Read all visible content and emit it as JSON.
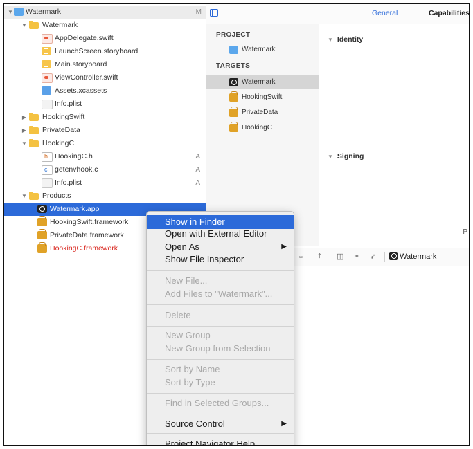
{
  "navigator": {
    "items": [
      {
        "label": "Watermark",
        "icon": "project-icon",
        "badge": "M"
      },
      {
        "label": "Watermark",
        "icon": "folder-icon",
        "badge": ""
      },
      {
        "label": "AppDelegate.swift",
        "icon": "swift-file-icon",
        "badge": ""
      },
      {
        "label": "LaunchScreen.storyboard",
        "icon": "storyboard-icon",
        "badge": ""
      },
      {
        "label": "Main.storyboard",
        "icon": "storyboard-icon",
        "badge": ""
      },
      {
        "label": "ViewController.swift",
        "icon": "swift-file-icon",
        "badge": ""
      },
      {
        "label": "Assets.xcassets",
        "icon": "assets-icon",
        "badge": ""
      },
      {
        "label": "Info.plist",
        "icon": "plist-icon",
        "badge": ""
      },
      {
        "label": "HookingSwift",
        "icon": "folder-icon",
        "badge": ""
      },
      {
        "label": "PrivateData",
        "icon": "folder-icon",
        "badge": ""
      },
      {
        "label": "HookingC",
        "icon": "folder-icon",
        "badge": ""
      },
      {
        "label": "HookingC.h",
        "icon": "header-file-icon",
        "badge": "A"
      },
      {
        "label": "getenvhook.c",
        "icon": "c-file-icon",
        "badge": "A"
      },
      {
        "label": "Info.plist",
        "icon": "plist-icon",
        "badge": "A"
      },
      {
        "label": "Products",
        "icon": "folder-icon",
        "badge": ""
      },
      {
        "label": "Watermark.app",
        "icon": "app-icon",
        "badge": ""
      },
      {
        "label": "HookingSwift.framework",
        "icon": "framework-icon",
        "badge": ""
      },
      {
        "label": "PrivateData.framework",
        "icon": "framework-icon",
        "badge": ""
      },
      {
        "label": "HookingC.framework",
        "icon": "framework-icon",
        "badge": ""
      }
    ]
  },
  "editor": {
    "tabs": {
      "general": "General",
      "capabilities": "Capabilities"
    },
    "project_header": "PROJECT",
    "project_item": "Watermark",
    "targets_header": "TARGETS",
    "targets": [
      "Watermark",
      "HookingSwift",
      "PrivateData",
      "HookingC"
    ],
    "sections": {
      "identity": "Identity",
      "signing": "Signing"
    },
    "truncated_right": "P",
    "debug_scheme": "Watermark"
  },
  "context_menu": {
    "items": [
      {
        "label": "Show in Finder"
      },
      {
        "label": "Open with External Editor"
      },
      {
        "label": "Open As"
      },
      {
        "label": "Show File Inspector"
      },
      {
        "label": "New File..."
      },
      {
        "label": "Add Files to \"Watermark\"..."
      },
      {
        "label": "Delete"
      },
      {
        "label": "New Group"
      },
      {
        "label": "New Group from Selection"
      },
      {
        "label": "Sort by Name"
      },
      {
        "label": "Sort by Type"
      },
      {
        "label": "Find in Selected Groups..."
      },
      {
        "label": "Source Control"
      },
      {
        "label": "Project Navigator Help"
      }
    ]
  },
  "colors": {
    "selection": "#2c6ad9",
    "missing_file": "#d9251d",
    "folder": "#f4c242"
  }
}
